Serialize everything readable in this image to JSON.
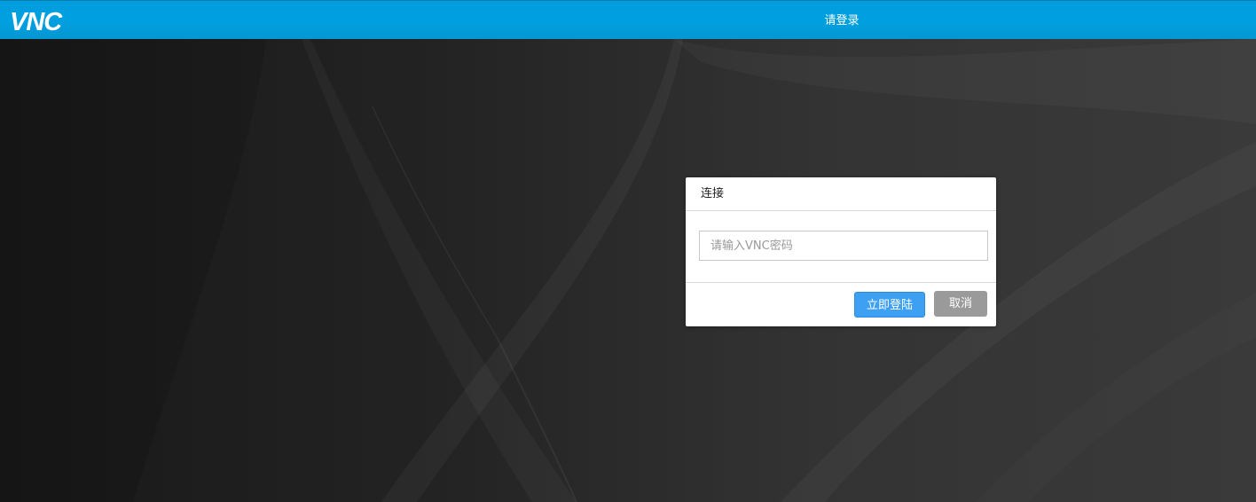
{
  "header": {
    "logo_text": "VNC",
    "title": "请登录"
  },
  "dialog": {
    "title": "连接",
    "password_input": {
      "value": "",
      "placeholder": "请输入VNC密码"
    },
    "login_button_label": "立即登陆",
    "cancel_button_label": "取消"
  },
  "colors": {
    "header_bg": "#00a0e0",
    "login_button": "#3ea0f2",
    "cancel_button": "#9a9a9a",
    "background_dark": "#1c1c1c"
  }
}
